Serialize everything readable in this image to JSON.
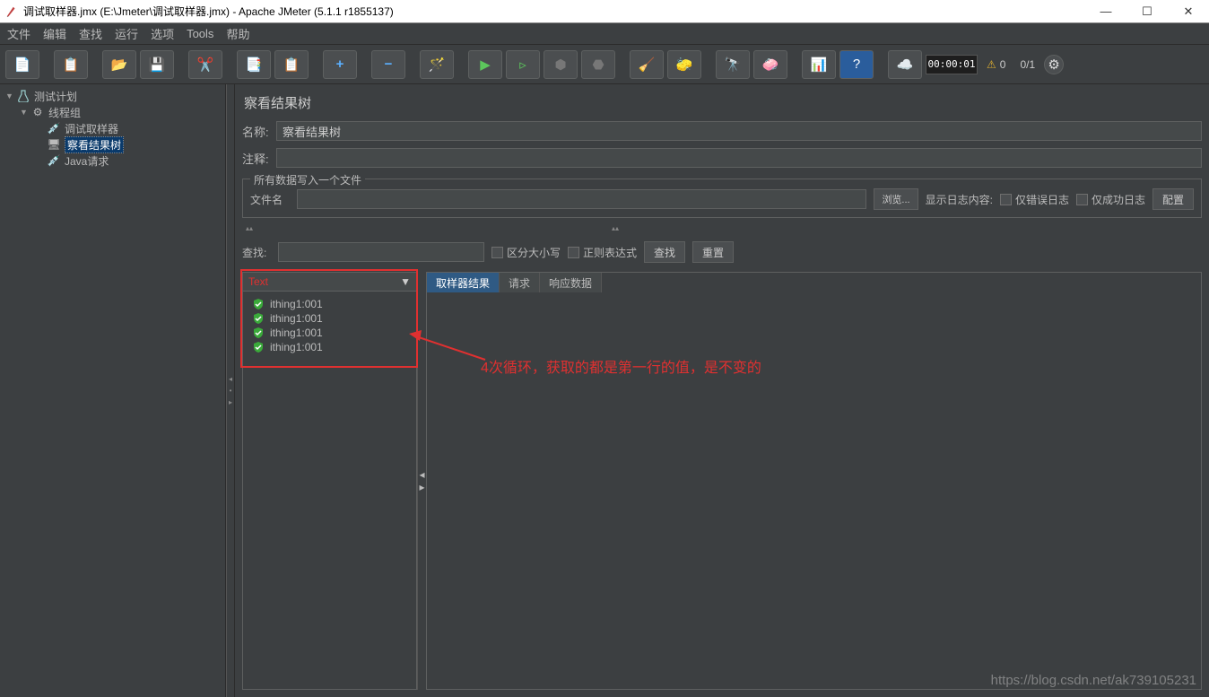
{
  "window": {
    "title": "调试取样器.jmx (E:\\Jmeter\\调试取样器.jmx) - Apache JMeter (5.1.1 r1855137)"
  },
  "menu": {
    "file": "文件",
    "edit": "编辑",
    "search": "查找",
    "run": "运行",
    "options": "选项",
    "tools": "Tools",
    "help": "帮助"
  },
  "toolbar": {
    "timer": "00:00:01",
    "warn_count": "0",
    "thread_count": "0/1"
  },
  "tree": {
    "root": "测试计划",
    "group": "线程组",
    "sampler": "调试取样器",
    "listener": "察看结果树",
    "java": "Java请求"
  },
  "panel": {
    "title": "察看结果树",
    "name_label": "名称:",
    "name_value": "察看结果树",
    "comment_label": "注释:",
    "fieldset_legend": "所有数据写入一个文件",
    "file_label": "文件名",
    "browse": "浏览...",
    "log_label": "显示日志内容:",
    "err_only": "仅错误日志",
    "ok_only": "仅成功日志",
    "config": "配置",
    "search_label": "查找:",
    "case_sens": "区分大小写",
    "regex": "正则表达式",
    "search_btn": "查找",
    "reset_btn": "重置",
    "dropdown": "Text",
    "tabs": {
      "sampler": "取样器结果",
      "request": "请求",
      "response": "响应数据"
    },
    "results": [
      "ithing1:001",
      "ithing1:001",
      "ithing1:001",
      "ithing1:001"
    ]
  },
  "annotation": {
    "text": "4次循环，获取的都是第一行的值，是不变的"
  },
  "watermark": "https://blog.csdn.net/ak739105231"
}
